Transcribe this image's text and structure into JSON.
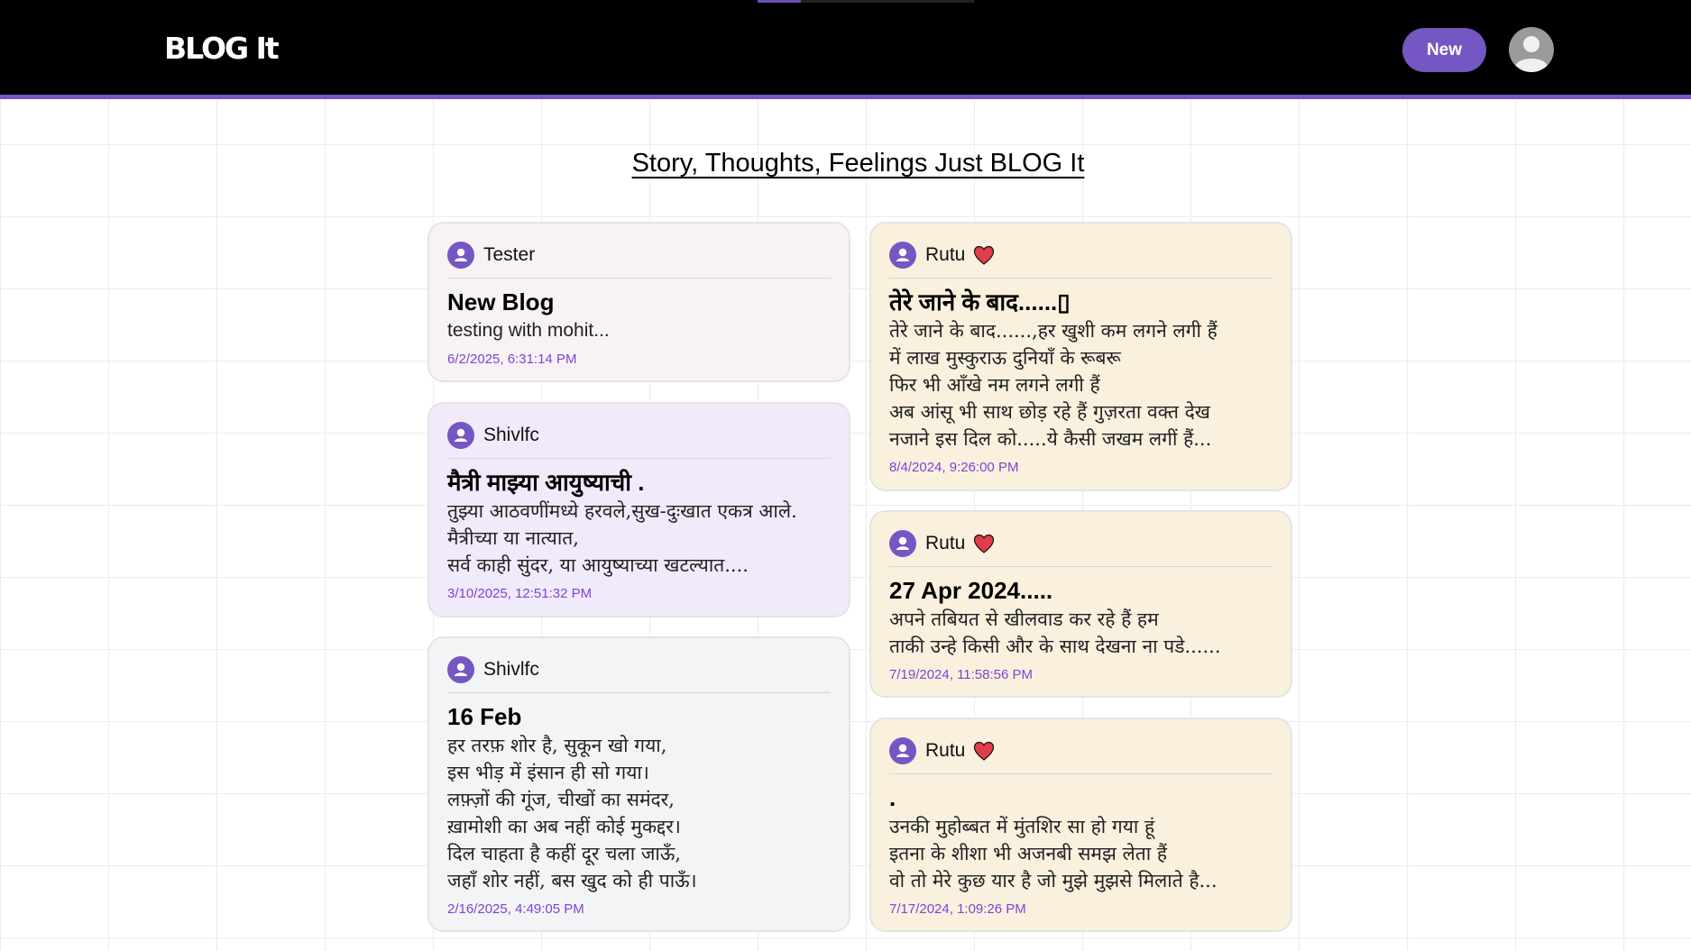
{
  "header": {
    "logo": "BLOG It",
    "new_button": "New"
  },
  "headline": "Story, Thoughts, Feelings Just BLOG It",
  "colors": {
    "accent": "#7457c2",
    "date": "#7e43d6",
    "heart": "#e23b4a"
  },
  "posts": [
    {
      "author": "Tester",
      "title": "New Blog",
      "body": "testing with mohit...",
      "date": "6/2/2025, 6:31:14 PM",
      "bg": "#f7f3f4"
    },
    {
      "author": "Shivlfc",
      "title": "मैत्री माझ्या आयुष्याची .",
      "body": "तुझ्या आठवणींमध्ये हरवले,सुख-दुःखात एकत्र आले.\nमैत्रीच्या या नात्यात,\nसर्व काही सुंदर, या आयुष्याच्या खटल्यात....",
      "date": "3/10/2025, 12:51:32 PM",
      "bg": "#f1eafa"
    },
    {
      "author": "Shivlfc",
      "title": "16 Feb",
      "body": "हर तरफ़ शोर है, सुकून खो गया,\nइस भीड़ में इंसान ही सो गया।\nलफ़्ज़ों की गूंज, चीखों का समंदर,\nख़ामोशी का अब नहीं कोई मुकद्दर।\nदिल चाहता है कहीं दूर चला जाऊँ,\nजहाँ शोर नहीं, बस खुद को ही पाऊँ।",
      "date": "2/16/2025, 4:49:05 PM",
      "bg": "#f3f4f6"
    },
    {
      "author": "Rutu",
      "title": "तेरे जाने के बाद......▯",
      "body": "तेरे जाने के बाद......,हर खुशी कम लगने लगी हैं\nमें लाख मुस्कुराऊ दुनियाँ के रूबरू\nफिर भी आँखे नम लगने लगी हैं\nअब आंसू भी साथ छोड़ रहे हैं गुज़रता वक्त देख\nनजाने इस दिल को.....ये कैसी जखम लगीं हैं...",
      "date": "8/4/2024, 9:26:00 PM",
      "bg": "#f9f1de",
      "heart": "heart-icon"
    },
    {
      "author": "Rutu",
      "title": "27 Apr 2024.....",
      "body": "अपने तबियत से खीलवाड कर रहे हैं हम\nताकी उन्हे किसी और के साथ देखना ना पडे......",
      "date": "7/19/2024, 11:58:56 PM",
      "bg": "#f9f1de",
      "heart": "heart-icon"
    },
    {
      "author": "Rutu",
      "title": ".",
      "body": "उनकी मुहोब्बत में मुंतशिर सा हो गया हूं\nइतना के शीशा भी अजनबी समझ लेता हैं\nवो तो मेरे कुछ यार है जो मुझे मुझसे मिलाते है...",
      "date": "7/17/2024, 1:09:26 PM",
      "bg": "#f9f1de",
      "heart": "heart-icon"
    }
  ]
}
